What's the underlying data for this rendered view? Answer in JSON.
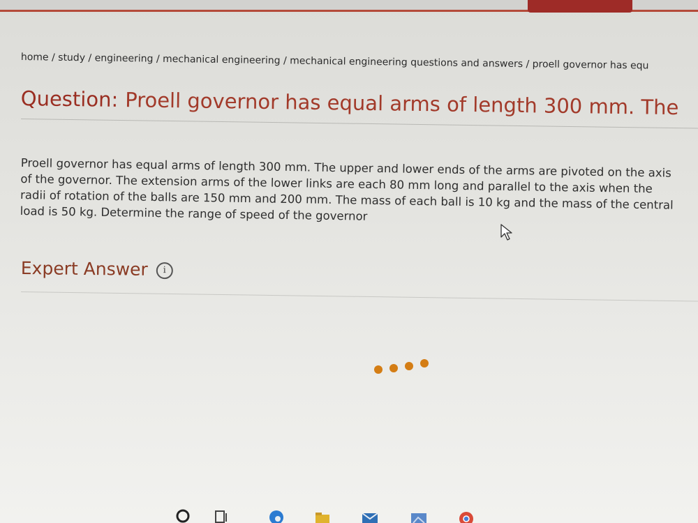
{
  "breadcrumb": {
    "items": [
      "home",
      "study",
      "engineering",
      "mechanical engineering",
      "mechanical engineering questions and answers",
      "proell governor has equ"
    ],
    "separator": " / "
  },
  "question": {
    "label": "Question:",
    "title": "Proell governor has equal arms of length 300 mm. The",
    "body": "Proell governor has equal arms of length 300 mm. The upper and lower ends of the arms are pivoted on the axis of the governor. The extension arms of the lower links are each 80 mm long and parallel to the axis when the radii of rotation of the balls are 150 mm and 200 mm. The mass of each ball is 10 kg and the mass of the central load is 50 kg. Determine the range of speed of the governor"
  },
  "expert_answer": {
    "heading": "Expert Answer",
    "info_glyph": "i",
    "loading": true
  },
  "colors": {
    "accent": "#9a2e22",
    "loader_dot": "#d47d14",
    "topbar_button": "#9e2b27"
  },
  "taskbar": {
    "icons": [
      "search-circle-icon",
      "task-view-icon",
      "edge-icon",
      "file-explorer-icon",
      "mail-icon",
      "photos-icon",
      "chrome-icon"
    ]
  }
}
